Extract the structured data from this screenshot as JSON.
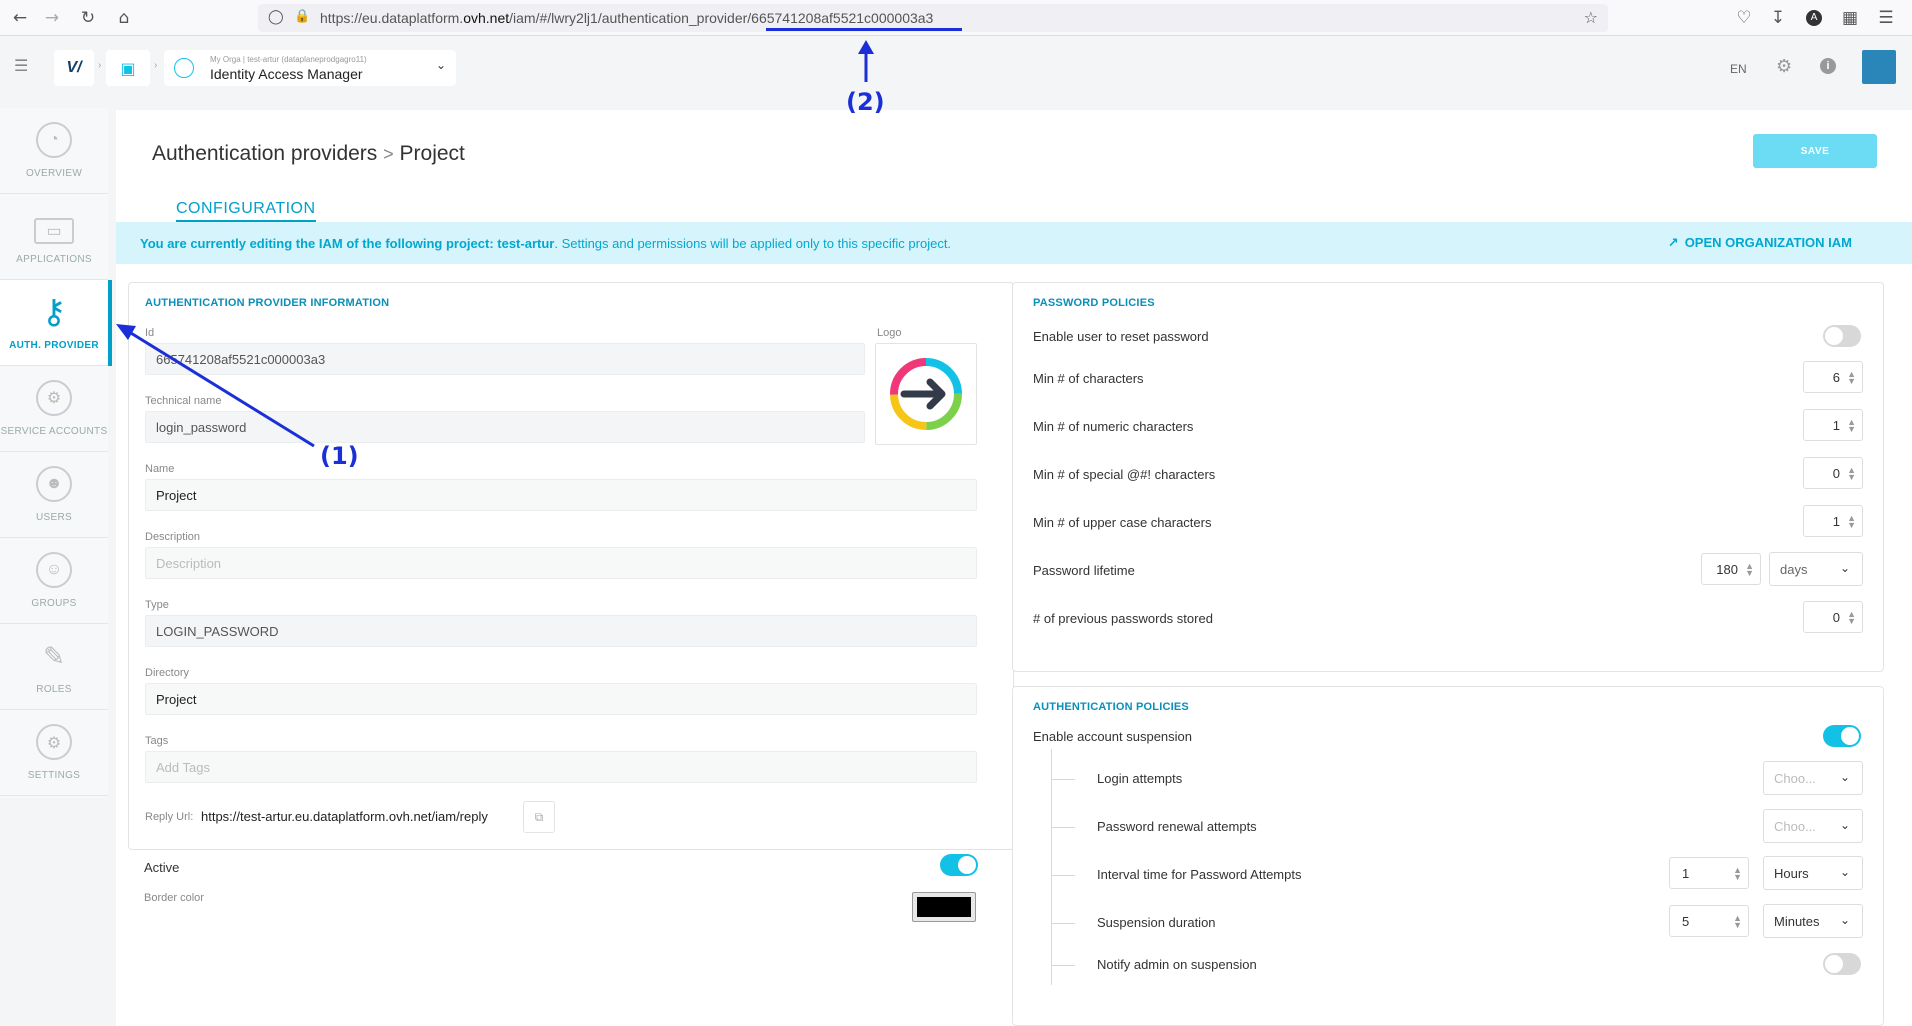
{
  "browser": {
    "url_prefix": "https://eu.dataplatform.",
    "url_domain": "ovh.net",
    "url_path": "/iam/#/lwry2lj1/authentication_provider/",
    "url_id": "665741208af5521c000003a3"
  },
  "header": {
    "org_label": "My Orga",
    "project_label": "test-artur (dataplaneprodgagro11)",
    "app_title": "Identity Access Manager",
    "lang": "EN"
  },
  "sidebar": {
    "items": [
      {
        "label": "OVERVIEW"
      },
      {
        "label": "APPLICATIONS"
      },
      {
        "label": "AUTH. PROVIDER"
      },
      {
        "label": "SERVICE ACCOUNTS"
      },
      {
        "label": "USERS"
      },
      {
        "label": "GROUPS"
      },
      {
        "label": "ROLES"
      },
      {
        "label": "SETTINGS"
      }
    ]
  },
  "page": {
    "breadcrumb_parent": "Authentication providers",
    "breadcrumb_sep": ">",
    "breadcrumb_current": "Project",
    "save_label": "SAVE",
    "tab_label": "CONFIGURATION"
  },
  "banner": {
    "strong": "You are currently editing the IAM of the following project: test-artur",
    "rest": ". Settings and permissions will be applied only to this specific project.",
    "link": "OPEN ORGANIZATION IAM"
  },
  "info": {
    "title": "AUTHENTICATION PROVIDER INFORMATION",
    "id_label": "Id",
    "id_value": "665741208af5521c000003a3",
    "logo_label": "Logo",
    "technical_label": "Technical name",
    "technical_value": "login_password",
    "name_label": "Name",
    "name_value": "Project",
    "description_label": "Description",
    "description_placeholder": "Description",
    "type_label": "Type",
    "type_value": "LOGIN_PASSWORD",
    "directory_label": "Directory",
    "directory_value": "Project",
    "tags_label": "Tags",
    "tags_placeholder": "Add Tags",
    "reply_label": "Reply Url:",
    "reply_value": "https://test-artur.eu.dataplatform.ovh.net/iam/reply",
    "active_label": "Active",
    "border_label": "Border color",
    "border_color": "#000000"
  },
  "password_policies": {
    "title": "PASSWORD POLICIES",
    "reset_label": "Enable user to reset password",
    "min_chars_label": "Min # of characters",
    "min_chars": "6",
    "min_numeric_label": "Min # of numeric characters",
    "min_numeric": "1",
    "min_special_label": "Min # of special @#! characters",
    "min_special": "0",
    "min_upper_label": "Min # of upper case characters",
    "min_upper": "1",
    "lifetime_label": "Password lifetime",
    "lifetime": "180",
    "lifetime_unit": "days",
    "previous_label": "# of previous passwords stored",
    "previous": "0"
  },
  "auth_policies": {
    "title": "AUTHENTICATION POLICIES",
    "suspension_label": "Enable account suspension",
    "login_attempts_label": "Login attempts",
    "login_attempts_placeholder": "Choo...",
    "renewal_label": "Password renewal attempts",
    "renewal_placeholder": "Choo...",
    "interval_label": "Interval time for Password Attempts",
    "interval_value": "1",
    "interval_unit": "Hours",
    "duration_label": "Suspension duration",
    "duration_value": "5",
    "duration_unit": "Minutes",
    "notify_label": "Notify admin on suspension"
  },
  "annotations": {
    "a1": "(1)",
    "a2": "(2)"
  },
  "colors": {
    "accent": "#00a0c8",
    "annotation": "#1a2fd8",
    "save_button": "#6cdcf4",
    "banner_bg": "#d6f4fb"
  }
}
